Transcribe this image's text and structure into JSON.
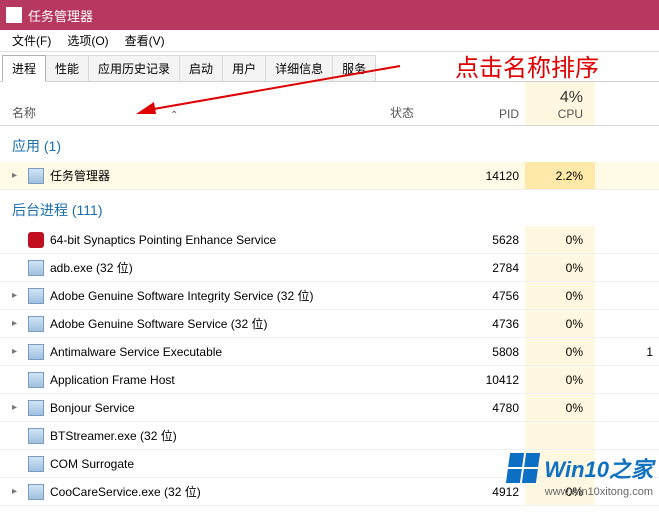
{
  "window": {
    "title": "任务管理器"
  },
  "menu": {
    "file": "文件(F)",
    "options": "选项(O)",
    "view": "查看(V)"
  },
  "tabs": {
    "processes": "进程",
    "performance": "性能",
    "history": "应用历史记录",
    "startup": "启动",
    "users": "用户",
    "details": "详细信息",
    "services": "服务"
  },
  "annotation": "点击名称排序",
  "headers": {
    "name": "名称",
    "status": "状态",
    "pid": "PID",
    "cpu_value": "4%",
    "cpu_label": "CPU"
  },
  "groups": {
    "apps": {
      "title": "应用 (1)"
    },
    "background": {
      "title": "后台进程 (111)"
    }
  },
  "rows": {
    "taskmgr": {
      "name": "任务管理器",
      "pid": "14120",
      "cpu": "2.2%",
      "extra": ""
    },
    "syn": {
      "name": "64-bit Synaptics Pointing Enhance Service",
      "pid": "5628",
      "cpu": "0%",
      "extra": ""
    },
    "adb": {
      "name": "adb.exe (32 位)",
      "pid": "2784",
      "cpu": "0%",
      "extra": ""
    },
    "agsi": {
      "name": "Adobe Genuine Software Integrity Service (32 位)",
      "pid": "4756",
      "cpu": "0%",
      "extra": ""
    },
    "ags": {
      "name": "Adobe Genuine Software Service (32 位)",
      "pid": "4736",
      "cpu": "0%",
      "extra": ""
    },
    "antim": {
      "name": "Antimalware Service Executable",
      "pid": "5808",
      "cpu": "0%",
      "extra": "1"
    },
    "afh": {
      "name": "Application Frame Host",
      "pid": "10412",
      "cpu": "0%",
      "extra": ""
    },
    "bonjour": {
      "name": "Bonjour Service",
      "pid": "4780",
      "cpu": "0%",
      "extra": ""
    },
    "bts": {
      "name": "BTStreamer.exe (32 位)",
      "pid": "",
      "cpu": "",
      "extra": ""
    },
    "com": {
      "name": "COM Surrogate",
      "pid": "",
      "cpu": "",
      "extra": ""
    },
    "coocare": {
      "name": "CooCareService.exe (32 位)",
      "pid": "4912",
      "cpu": "0%",
      "extra": ""
    }
  },
  "watermark": {
    "brand": "Win10之家",
    "site": "www.win10xitong.com"
  }
}
